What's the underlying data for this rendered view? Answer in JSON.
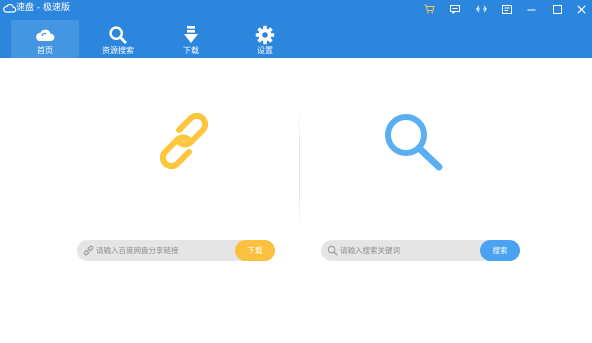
{
  "app": {
    "title": "速盘 - 极速版"
  },
  "window_controls": {
    "icons": [
      "cart-icon",
      "message-icon",
      "share-icon",
      "list-icon",
      "minimize-icon",
      "maximize-icon",
      "close-icon"
    ]
  },
  "nav": {
    "tabs": [
      {
        "label": "首页",
        "icon": "cloud-icon",
        "active": true
      },
      {
        "label": "资源搜索",
        "icon": "search-icon",
        "active": false
      },
      {
        "label": "下载",
        "icon": "download-arrow-icon",
        "active": false
      },
      {
        "label": "设置",
        "icon": "gear-icon",
        "active": false
      }
    ]
  },
  "left_panel": {
    "icon": "chain-link-icon",
    "input_placeholder": "请输入百度网盘分享链接",
    "button_label": "下载"
  },
  "right_panel": {
    "icon": "magnifier-icon",
    "input_placeholder": "请输入搜索关键词",
    "button_label": "搜索"
  },
  "colors": {
    "header": "#2d86dd",
    "active_tab": "#4496e3",
    "link_yellow": "#fcc63e",
    "download_button": "#fcc040",
    "search_blue": "#5aaef2",
    "search_button": "#4aa2f0",
    "cart_icon": "#f7c948",
    "input_bg": "#e5e5e5"
  }
}
